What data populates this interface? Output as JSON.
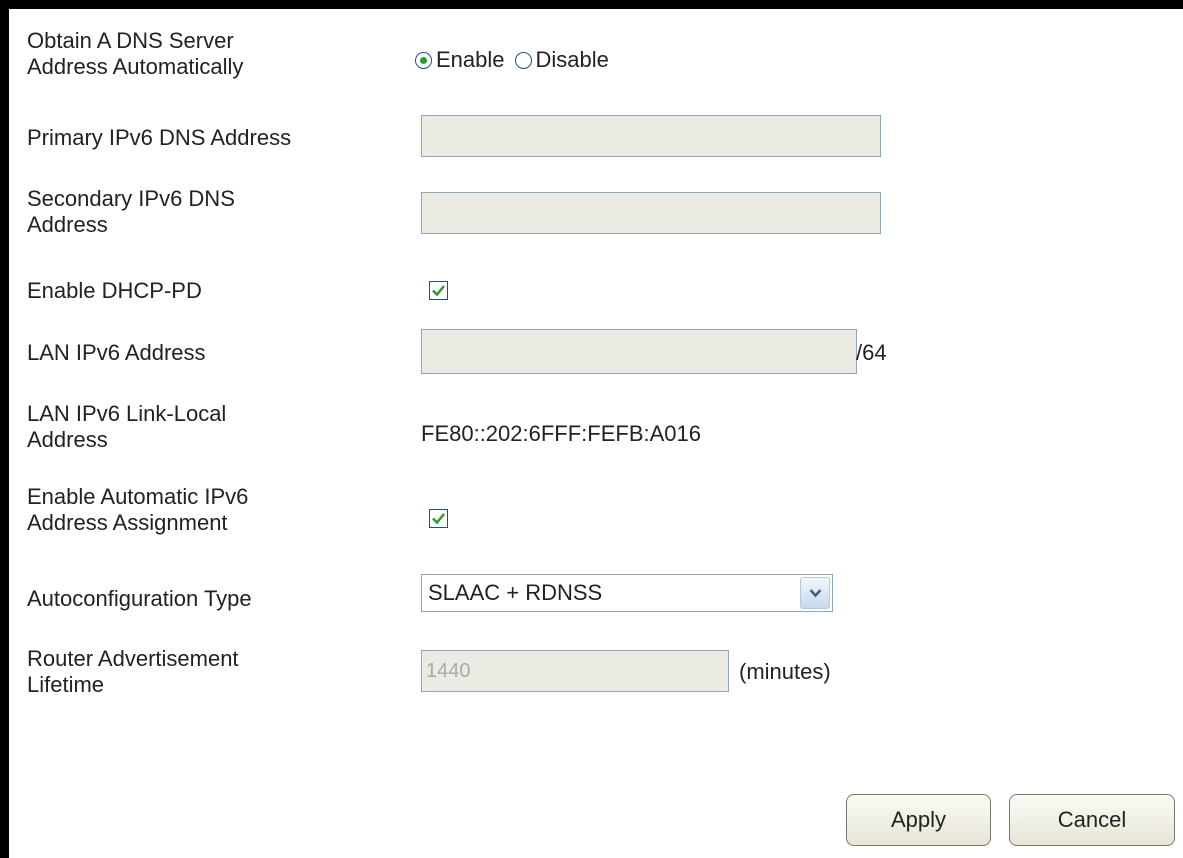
{
  "labels": {
    "obtain_dns": "Obtain A DNS Server\nAddress Automatically",
    "primary_dns": "Primary IPv6 DNS Address",
    "secondary_dns": "Secondary IPv6 DNS\nAddress",
    "enable_dhcp_pd": "Enable DHCP-PD",
    "lan_ipv6": "LAN IPv6 Address",
    "lan_link_local": "LAN IPv6 Link-Local\nAddress",
    "auto_assign": "Enable Automatic IPv6\nAddress Assignment",
    "autoconfig_type": "Autoconfiguration Type",
    "router_adv": "Router Advertisement\nLifetime"
  },
  "dns_mode": {
    "enable_label": "Enable",
    "disable_label": "Disable",
    "selected": "Enable"
  },
  "fields": {
    "primary_dns_value": "",
    "secondary_dns_value": "",
    "lan_ipv6_value": "",
    "lan_prefix": "/64",
    "link_local_value": "FE80::202:6FFF:FEFB:A016",
    "lifetime_value": "1440",
    "lifetime_unit": "(minutes)"
  },
  "checkboxes": {
    "dhcp_pd_checked": true,
    "auto_assign_checked": true
  },
  "autoconfig": {
    "selected": "SLAAC + RDNSS"
  },
  "buttons": {
    "apply": "Apply",
    "cancel": "Cancel"
  },
  "colors": {
    "check_green": "#2f9a2f",
    "control_border": "#1c5180",
    "field_bg": "#ebebe4"
  }
}
